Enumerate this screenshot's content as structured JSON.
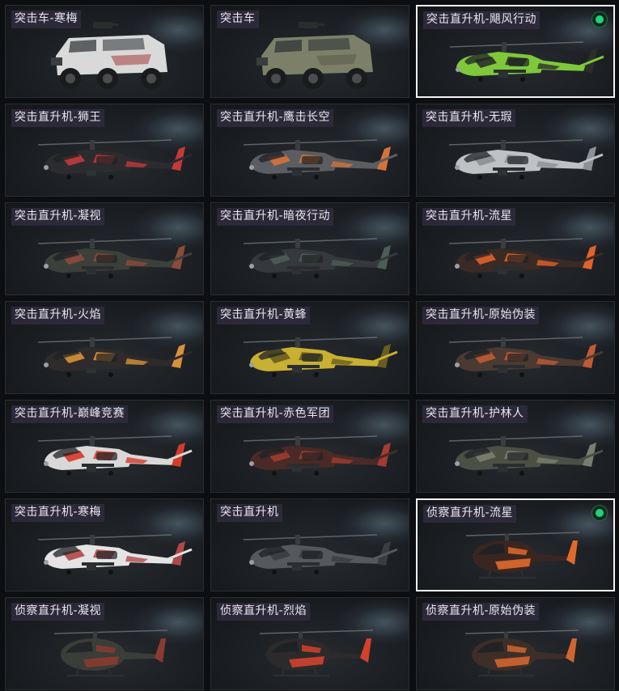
{
  "cards": [
    {
      "label": "突击车-寒梅",
      "kind": "armored-car",
      "primary": "#d9d9d9",
      "secondary": "#a84a4a",
      "selected": false,
      "equipped": false
    },
    {
      "label": "突击车",
      "kind": "armored-car",
      "primary": "#7d8068",
      "secondary": "#5b5e4c",
      "selected": false,
      "equipped": false
    },
    {
      "label": "突击直升机-飓风行动",
      "kind": "attack-heli",
      "primary": "#7ec83a",
      "secondary": "#2b2f2a",
      "selected": true,
      "equipped": true
    },
    {
      "label": "突击直升机-狮王",
      "kind": "attack-heli",
      "primary": "#2c2c2e",
      "secondary": "#c23a3a",
      "selected": false,
      "equipped": false
    },
    {
      "label": "突击直升机-鹰击长空",
      "kind": "attack-heli",
      "primary": "#5a5d61",
      "secondary": "#d5723a",
      "selected": false,
      "equipped": false
    },
    {
      "label": "突击直升机-无瑕",
      "kind": "attack-heli",
      "primary": "#bfc2c4",
      "secondary": "#8d9094",
      "selected": false,
      "equipped": false
    },
    {
      "label": "突击直升机-凝视",
      "kind": "attack-heli",
      "primary": "#3c403a",
      "secondary": "#8c4a3a",
      "selected": false,
      "equipped": false
    },
    {
      "label": "突击直升机-暗夜行动",
      "kind": "attack-heli",
      "primary": "#35383c",
      "secondary": "#4b5e55",
      "selected": false,
      "equipped": false
    },
    {
      "label": "突击直升机-流星",
      "kind": "attack-heli",
      "primary": "#3a2a24",
      "secondary": "#e0622c",
      "selected": false,
      "equipped": false
    },
    {
      "label": "突击直升机-火焰",
      "kind": "attack-heli",
      "primary": "#2e2b2a",
      "secondary": "#d9913a",
      "selected": false,
      "equipped": false
    },
    {
      "label": "突击直升机-黄蜂",
      "kind": "attack-heli",
      "primary": "#c8b032",
      "secondary": "#6a5c1e",
      "selected": false,
      "equipped": false
    },
    {
      "label": "突击直升机-原始伪装",
      "kind": "attack-heli",
      "primary": "#4a3a32",
      "secondary": "#c05a34",
      "selected": false,
      "equipped": false
    },
    {
      "label": "突击直升机-巅峰竞赛",
      "kind": "attack-heli",
      "primary": "#d8d8d8",
      "secondary": "#d63a2a",
      "selected": false,
      "equipped": false
    },
    {
      "label": "突击直升机-赤色军团",
      "kind": "attack-heli",
      "primary": "#4a2a26",
      "secondary": "#a03c30",
      "selected": false,
      "equipped": false
    },
    {
      "label": "突击直升机-护林人",
      "kind": "attack-heli",
      "primary": "#4c5044",
      "secondary": "#7a7e70",
      "selected": false,
      "equipped": false
    },
    {
      "label": "突击直升机-寒梅",
      "kind": "attack-heli",
      "primary": "#e4e4e4",
      "secondary": "#b04848",
      "selected": false,
      "equipped": false
    },
    {
      "label": "突击直升机",
      "kind": "attack-heli",
      "primary": "#55585c",
      "secondary": "#3a3d40",
      "selected": false,
      "equipped": false
    },
    {
      "label": "侦察直升机-流星",
      "kind": "scout-heli",
      "primary": "#3a2620",
      "secondary": "#e06a2c",
      "selected": true,
      "equipped": true
    },
    {
      "label": "侦察直升机-凝视",
      "kind": "scout-heli",
      "primary": "#3a3d38",
      "secondary": "#8c3a2e",
      "selected": false,
      "equipped": false
    },
    {
      "label": "侦察直升机-烈焰",
      "kind": "scout-heli",
      "primary": "#2c2a2a",
      "secondary": "#d2412c",
      "selected": false,
      "equipped": false
    },
    {
      "label": "侦察直升机-原始伪装",
      "kind": "scout-heli",
      "primary": "#3e2e28",
      "secondary": "#d06530",
      "selected": false,
      "equipped": false
    }
  ]
}
